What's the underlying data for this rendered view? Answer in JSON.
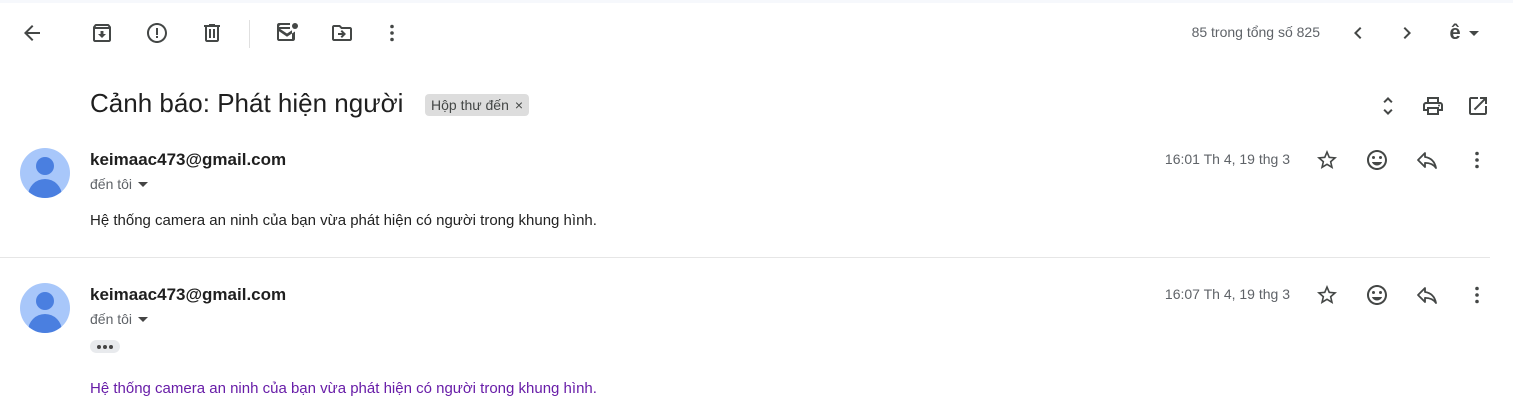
{
  "toolbar": {
    "pager_text": "85 trong tổng số 825",
    "input_tool_glyph": "ê"
  },
  "thread": {
    "subject": "Cảnh báo: Phát hiện người",
    "label": "Hộp thư đến",
    "label_remove": "×"
  },
  "messages": [
    {
      "sender": "keimaac473@gmail.com",
      "recipient": "đến tôi",
      "time": "16:01 Th 4, 19 thg 3",
      "body": "Hệ thống camera an ninh của bạn vừa phát hiện có người trong khung hình."
    },
    {
      "sender": "keimaac473@gmail.com",
      "recipient": "đến tôi",
      "time": "16:07 Th 4, 19 thg 3",
      "body": "Hệ thống camera an ninh của bạn vừa phát hiện có người trong khung hình."
    }
  ],
  "colors": {
    "avatar_bg": "#a8c7fa",
    "avatar_fg": "#4a7fe0",
    "visited_text": "#681da8"
  }
}
